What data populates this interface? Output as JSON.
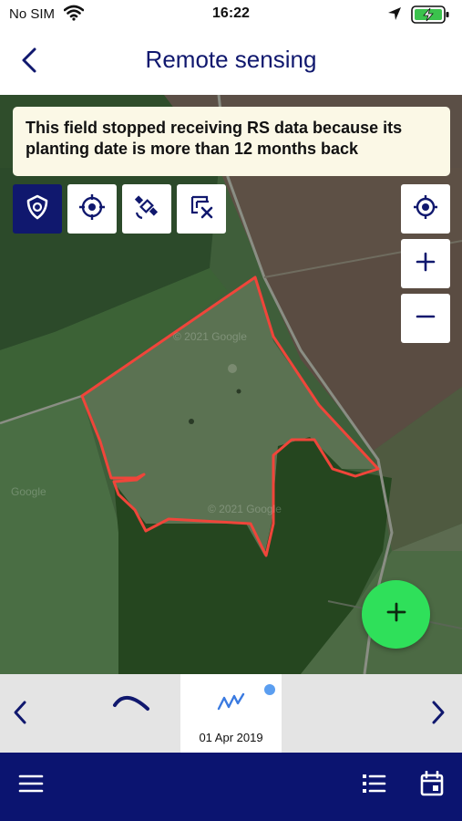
{
  "status_bar": {
    "carrier": "No SIM",
    "time": "16:22",
    "icons": [
      "wifi-icon",
      "location-arrow-icon",
      "battery-charging-icon"
    ]
  },
  "header": {
    "title": "Remote sensing",
    "back_icon": "chevron-left-icon"
  },
  "map": {
    "notice": "This field stopped receiving RS data because its planting date is more than 12 months back",
    "tools": [
      {
        "icon": "shield-check-icon",
        "active": true
      },
      {
        "icon": "crosshair-icon",
        "active": false
      },
      {
        "icon": "satellite-icon",
        "active": false
      },
      {
        "icon": "layers-remove-icon",
        "active": false
      }
    ],
    "controls": [
      "my-location-icon",
      "zoom-in-icon",
      "zoom-out-icon"
    ],
    "watermarks": [
      "© 2021 Google",
      "© 2021 Google",
      "Google"
    ],
    "field_outline_color": "#f0453a",
    "fab_icon": "plus-icon",
    "fab_color": "#2fe05a"
  },
  "date_strip": {
    "selected_date": "01 Apr 2019",
    "prev_icon": "chevron-left-icon",
    "next_icon": "chevron-right-icon",
    "indicator_color": "#5b9ef0"
  },
  "bottom_bar": {
    "icons": [
      "menu-icon",
      "list-icon",
      "calendar-icon"
    ],
    "color": "#0b1470"
  }
}
